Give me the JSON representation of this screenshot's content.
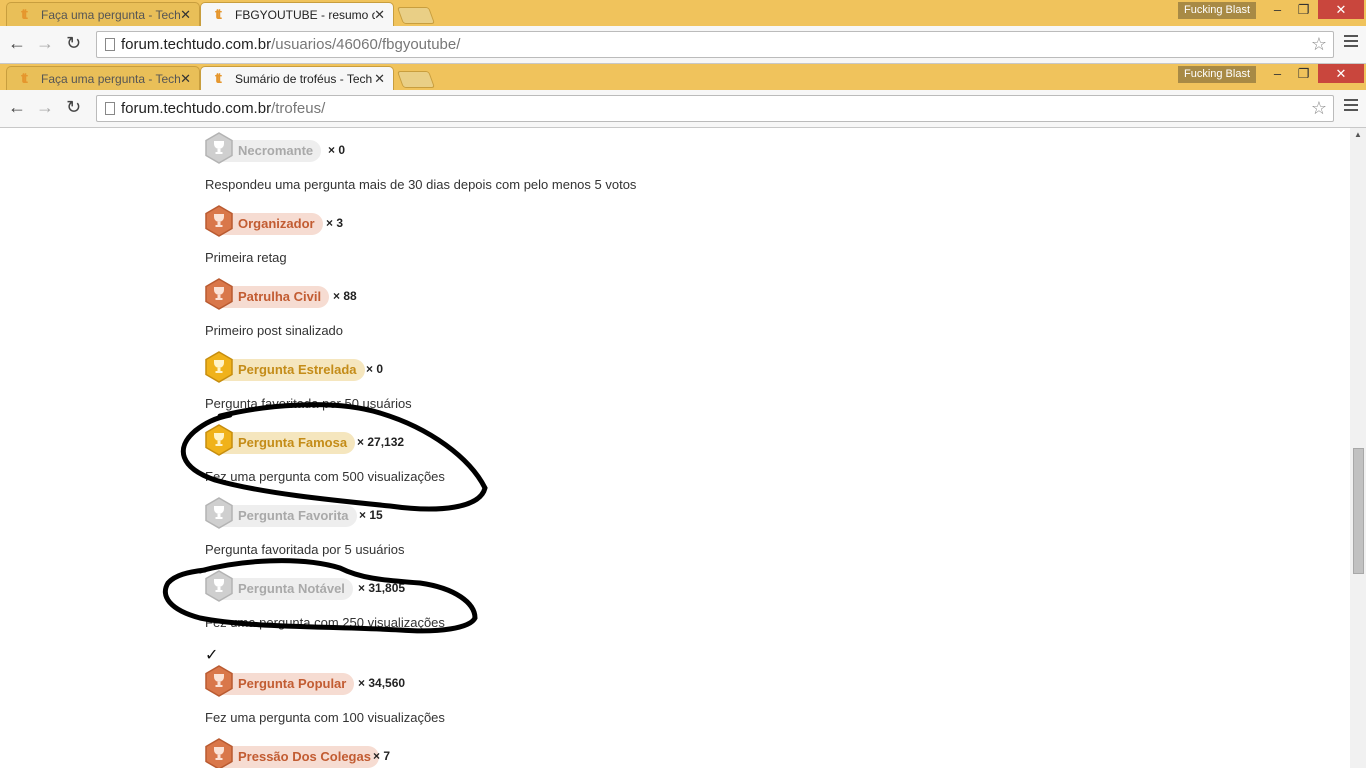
{
  "window1": {
    "tabs": [
      {
        "title": "Faça uma pergunta - Tech",
        "active": false
      },
      {
        "title": "FBGYOUTUBE - resumo de",
        "active": true
      }
    ],
    "profile_name": "Fucking Blast",
    "url_host": "forum.techtudo.com.br",
    "url_path": "/usuarios/46060/fbgyoutube/"
  },
  "window2": {
    "tabs": [
      {
        "title": "Faça uma pergunta - Tech",
        "active": false
      },
      {
        "title": "Sumário de troféus - Tech",
        "active": true
      }
    ],
    "profile_name": "Fucking Blast",
    "url_host": "forum.techtudo.com.br",
    "url_path": "/trofeus/"
  },
  "window_buttons": {
    "minimize": "–",
    "restore": "❐",
    "close": "✕"
  },
  "nav": {
    "back": "←",
    "forward": "→",
    "reload": "↻"
  },
  "colors": {
    "chrome": "#f0c35c",
    "silver": "#b9b9b9",
    "bronze": "#d2693c",
    "gold": "#e8a813"
  },
  "badges": [
    {
      "name": "Necromante",
      "tier": "silver",
      "count": "× 0",
      "description": "Respondeu uma pergunta mais de 30 dias depois com pelo menos 5 votos"
    },
    {
      "name": "Organizador",
      "tier": "bronze",
      "count": "× 3",
      "description": "Primeira retag"
    },
    {
      "name": "Patrulha Civil",
      "tier": "bronze",
      "count": "× 88",
      "description": "Primeiro post sinalizado"
    },
    {
      "name": "Pergunta Estrelada",
      "tier": "gold",
      "count": "× 0",
      "description": "Pergunta favoritada por 50 usuários"
    },
    {
      "name": "Pergunta Famosa",
      "tier": "gold",
      "count": "× 27,132",
      "description": "Fez uma pergunta com 500 visualizações"
    },
    {
      "name": "Pergunta Favorita",
      "tier": "silver",
      "count": "× 15",
      "description": "Pergunta favoritada por 5 usuários"
    },
    {
      "name": "Pergunta Notável",
      "tier": "silver",
      "count": "× 31,805",
      "description": "Fez uma pergunta com 250 visualizações"
    },
    {
      "name": "Pergunta Popular",
      "tier": "bronze",
      "count": "× 34,560",
      "description": "Fez uma pergunta com 100 visualizações"
    },
    {
      "name": "Pressão Dos Colegas",
      "tier": "bronze",
      "count": "× 7",
      "description": ""
    }
  ],
  "earned_mark": "✓"
}
